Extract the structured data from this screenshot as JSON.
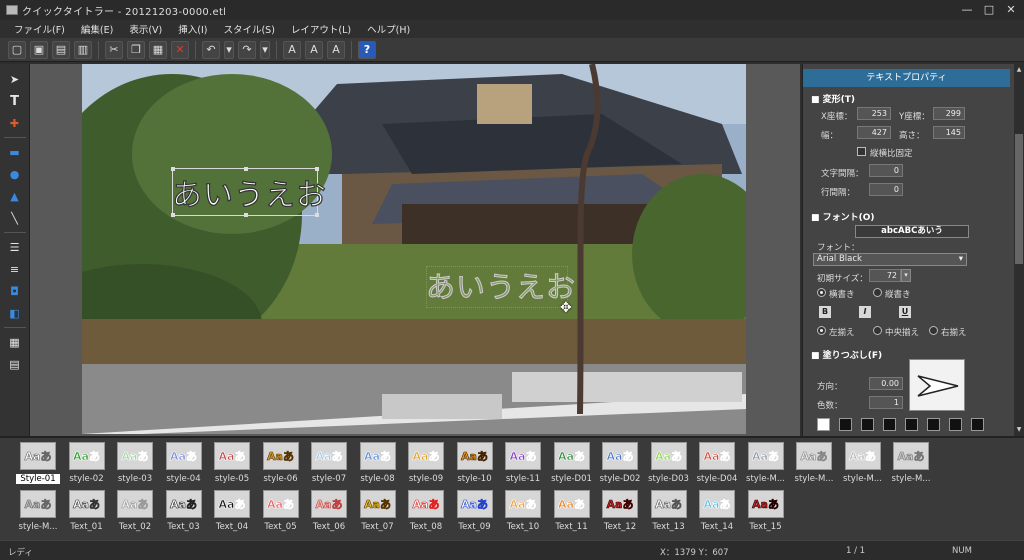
{
  "window": {
    "title": "クイックタイトラー - 20121203-0000.etl",
    "controls": [
      "—",
      "□",
      "✕"
    ]
  },
  "menu": [
    "ファイル(F)",
    "編集(E)",
    "表示(V)",
    "挿入(I)",
    "スタイル(S)",
    "レイアウト(L)",
    "ヘルプ(H)"
  ],
  "toolbar_icons": [
    "new-icon",
    "open-icon",
    "save-icon",
    "save-all-icon",
    "cut-icon",
    "copy-icon",
    "paste-icon",
    "delete-icon",
    "undo-icon",
    "redo-icon",
    "text-effect-icon",
    "text-style-icon",
    "text-adjust-icon",
    "help-icon"
  ],
  "left_tools": [
    "select-icon",
    "text-icon",
    "move-icon",
    "rectangle-icon",
    "ellipse-icon",
    "triangle-icon",
    "line-icon",
    "align-icon",
    "distribute-icon",
    "group-icon",
    "layer-icon",
    "grid-icon",
    "table-icon"
  ],
  "canvas": {
    "text1": "あいうえお",
    "text2": "あいうえお"
  },
  "props": {
    "header": "テキストプロパティ",
    "transform": {
      "title": "変形(T)",
      "x_label": "X座標：",
      "x": "253",
      "y_label": "Y座標：",
      "y": "299",
      "w_label": "幅：",
      "w": "427",
      "h_label": "高さ：",
      "h": "145",
      "lock_label": "縦横比固定",
      "char_spacing_label": "文字間隔：",
      "char_spacing": "0",
      "line_spacing_label": "行間隔：",
      "line_spacing": "0"
    },
    "font": {
      "title": "フォント(O)",
      "preview": "abcABCあいう",
      "label": "フォント：",
      "name": "Arial Black",
      "size_label": "初期サイズ：",
      "size": "72",
      "horizontal": "横書き",
      "vertical": "縦書き",
      "bold": "B",
      "italic": "I",
      "underline": "U",
      "left": "左揃え",
      "center": "中央揃え",
      "right": "右揃え"
    },
    "fill": {
      "title": "塗りつぶし(F)",
      "direction_label": "方向：",
      "direction": "0.00",
      "colors_label": "色数：",
      "colors": "1",
      "swatches": [
        "#ffffff",
        "#111111",
        "#111111",
        "#111111",
        "#111111",
        "#111111",
        "#111111",
        "#111111"
      ]
    }
  },
  "styles_row1": [
    {
      "name": "Style-01",
      "sample": "Aaあ",
      "bg": "#d6d6d6",
      "fg": "#ffffff",
      "stroke": "#666666"
    },
    {
      "name": "style-02",
      "sample": "Aaあ",
      "bg": "#d6d6d6",
      "fg": "#2c9a2c",
      "stroke": "#ffffff"
    },
    {
      "name": "style-03",
      "sample": "Aaあ",
      "bg": "#d6d6d6",
      "fg": "#9fd6a5",
      "stroke": "#ffffff"
    },
    {
      "name": "style-04",
      "sample": "Aaあ",
      "bg": "#d6d6d6",
      "fg": "#7a8ad8",
      "stroke": "#ffffff"
    },
    {
      "name": "style-05",
      "sample": "Aaあ",
      "bg": "#d6d6d6",
      "fg": "#c04848",
      "stroke": "#ffffff"
    },
    {
      "name": "style-06",
      "sample": "Aaあ",
      "bg": "#d6d6d6",
      "fg": "#d8a030",
      "stroke": "#553300"
    },
    {
      "name": "style-07",
      "sample": "Aaあ",
      "bg": "#d6d6d6",
      "fg": "#a8c8e8",
      "stroke": "#ffffff"
    },
    {
      "name": "style-08",
      "sample": "Aaあ",
      "bg": "#d6d6d6",
      "fg": "#5a8ad8",
      "stroke": "#ffffff"
    },
    {
      "name": "style-09",
      "sample": "Aaあ",
      "bg": "#d6d6d6",
      "fg": "#e0a020",
      "stroke": "#ffffff"
    },
    {
      "name": "style-10",
      "sample": "Aaあ",
      "bg": "#d6d6d6",
      "fg": "#e89a20",
      "stroke": "#442200"
    },
    {
      "name": "style-11",
      "sample": "Aaあ",
      "bg": "#d6d6d6",
      "fg": "#8a3ac8",
      "stroke": "#ffffff"
    },
    {
      "name": "style-D01",
      "sample": "Aaあ",
      "bg": "#d6d6d6",
      "fg": "#2a8a3a",
      "stroke": "#ffffff"
    },
    {
      "name": "style-D02",
      "sample": "Aaあ",
      "bg": "#d6d6d6",
      "fg": "#4a7ac8",
      "stroke": "#ffffff"
    },
    {
      "name": "style-D03",
      "sample": "Aaあ",
      "bg": "#d6d6d6",
      "fg": "#8ad84a",
      "stroke": "#ffffff"
    },
    {
      "name": "style-D04",
      "sample": "Aaあ",
      "bg": "#d6d6d6",
      "fg": "#d84a3a",
      "stroke": "#ffffff"
    },
    {
      "name": "style-M...",
      "sample": "Aaあ",
      "bg": "#d6d6d6",
      "fg": "#9098a8",
      "stroke": "#ffffff"
    },
    {
      "name": "style-M...",
      "sample": "Aaあ",
      "bg": "#d6d6d6",
      "fg": "#e8e8e8",
      "stroke": "#888888"
    },
    {
      "name": "style-M...",
      "sample": "Aaあ",
      "bg": "#d6d6d6",
      "fg": "#bbbbbb",
      "stroke": "#ffffff"
    },
    {
      "name": "style-M...",
      "sample": "Aaあ",
      "bg": "#d6d6d6",
      "fg": "#c8c8c8",
      "stroke": "#777777"
    }
  ],
  "styles_row2": [
    {
      "name": "style-M...",
      "sample": "Aaあ",
      "bg": "#d6d6d6",
      "fg": "#bbbbbb",
      "stroke": "#666666"
    },
    {
      "name": "Text_01",
      "sample": "Aaあ",
      "bg": "#d6d6d6",
      "fg": "#ffffff",
      "stroke": "#333333"
    },
    {
      "name": "Text_02",
      "sample": "Aaあ",
      "bg": "#d6d6d6",
      "fg": "#f0f0f0",
      "stroke": "#999999"
    },
    {
      "name": "Text_03",
      "sample": "Aaあ",
      "bg": "#d6d6d6",
      "fg": "#ffffff",
      "stroke": "#222222"
    },
    {
      "name": "Text_04",
      "sample": "Aaあ",
      "bg": "#d6d6d6",
      "fg": "#111111",
      "stroke": "#ffffff"
    },
    {
      "name": "Text_05",
      "sample": "Aaあ",
      "bg": "#d6d6d6",
      "fg": "#e85a5a",
      "stroke": "#ffffff"
    },
    {
      "name": "Text_06",
      "sample": "Aaあ",
      "bg": "#d6d6d6",
      "fg": "#f0c0b0",
      "stroke": "#c04040"
    },
    {
      "name": "Text_07",
      "sample": "Aaあ",
      "bg": "#d6d6d6",
      "fg": "#f0c020",
      "stroke": "#553300"
    },
    {
      "name": "Text_08",
      "sample": "Aaあ",
      "bg": "#d6d6d6",
      "fg": "#ffffff",
      "stroke": "#e02020"
    },
    {
      "name": "Text_09",
      "sample": "Aaあ",
      "bg": "#d6d6d6",
      "fg": "#ffffff",
      "stroke": "#2040d0"
    },
    {
      "name": "Text_10",
      "sample": "Aaあ",
      "bg": "#d6d6d6",
      "fg": "#f0a040",
      "stroke": "#ffffff"
    },
    {
      "name": "Text_11",
      "sample": "Aaあ",
      "bg": "#d6d6d6",
      "fg": "#f08020",
      "stroke": "#ffffff"
    },
    {
      "name": "Text_12",
      "sample": "Aaあ",
      "bg": "#d6d6d6",
      "fg": "#c02020",
      "stroke": "#400000"
    },
    {
      "name": "Text_13",
      "sample": "Aaあ",
      "bg": "#d6d6d6",
      "fg": "#ffffff",
      "stroke": "#555555"
    },
    {
      "name": "Text_14",
      "sample": "Aaあ",
      "bg": "#d6d6d6",
      "fg": "#60c0e0",
      "stroke": "#ffffff"
    },
    {
      "name": "Text_15",
      "sample": "Aaあ",
      "bg": "#d6d6d6",
      "fg": "#c82020",
      "stroke": "#200000"
    }
  ],
  "status": {
    "ready": "レディ",
    "coords": "X：1379  Y：607",
    "page": "1 / 1",
    "num": "NUM"
  }
}
